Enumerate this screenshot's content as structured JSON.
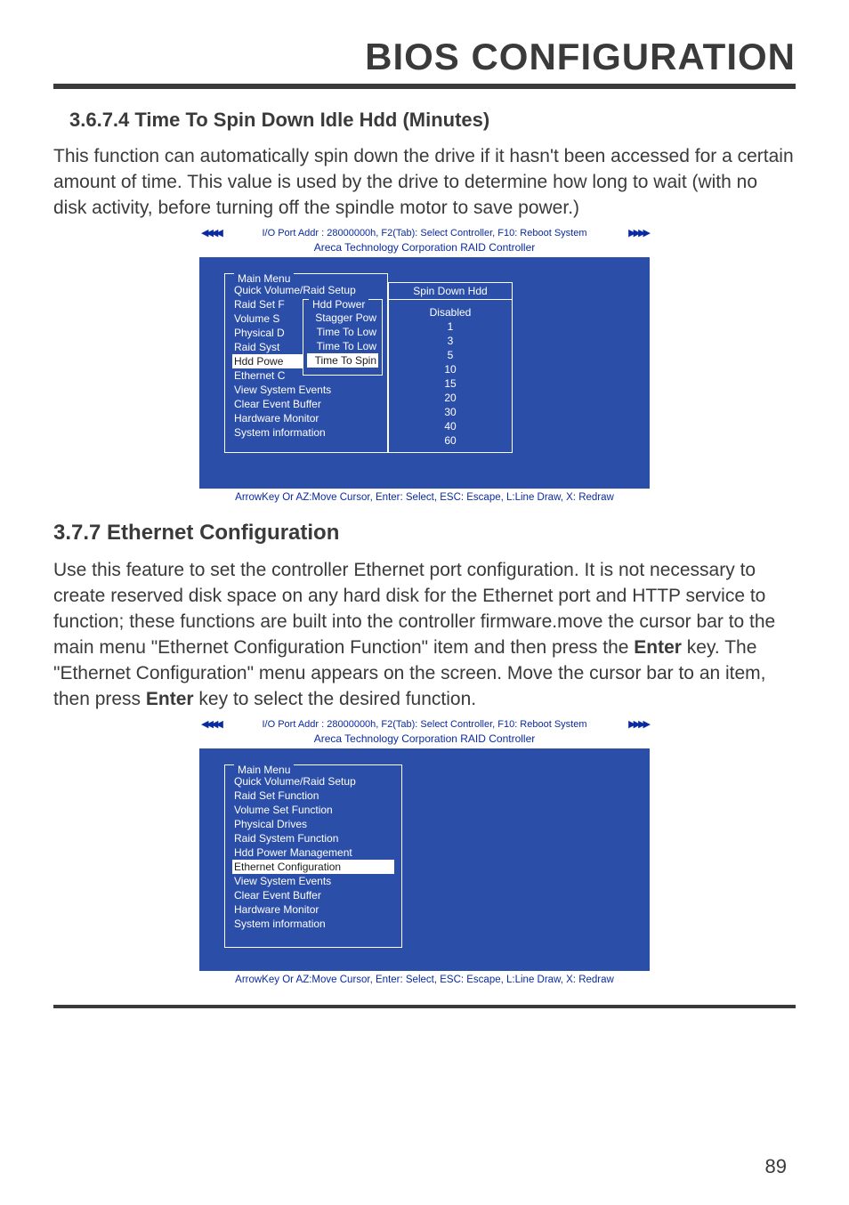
{
  "header": "BIOS CONFIGURATION",
  "section1": {
    "num_title": "3.6.7.4 Time To Spin Down Idle Hdd (Minutes)",
    "para": "This function can automatically spin down the drive if it hasn't been accessed for a certain amount of time. This value is used by the drive to determine how long to wait (with no disk activity, before turning off the spindle motor to save power.)"
  },
  "bios_common": {
    "top_status": "I/O Port Addr : 28000000h, F2(Tab): Select Controller, F10: Reboot System",
    "corp": "Areca Technology Corporation RAID Controller",
    "help": "ArrowKey Or AZ:Move Cursor, Enter: Select, ESC: Escape, L:Line Draw, X: Redraw",
    "main_menu_title": "Main Menu",
    "arrows_l": "◀◀◀◀",
    "arrows_r": "▶▶▶▶"
  },
  "bios1": {
    "main_items": [
      "Quick Volume/Raid Setup",
      "Raid Set F",
      "Volume S",
      "Physical D",
      "Raid Syst",
      "Hdd Powe",
      "Ethernet C",
      "View System Events",
      "Clear Event Buffer",
      "Hardware Monitor",
      "System information"
    ],
    "sub_title": "Hdd Power",
    "sub_items": [
      "Stagger Pow",
      "Time To Low",
      "Time To Low",
      "Time To Spin"
    ],
    "popup_title": "Spin Down Hdd",
    "popup_items": [
      "Disabled",
      "1",
      "3",
      "5",
      "10",
      "15",
      "20",
      "30",
      "40",
      "60"
    ]
  },
  "section2": {
    "title": "3.7.7 Ethernet Configuration",
    "para_a": "Use this feature to set the controller Ethernet port configuration. It is not necessary to create reserved disk space on any hard disk for the Ethernet port and HTTP service to function; these functions are built into the controller firmware.move the cursor bar to the main menu \"Ethernet Configuration Function\" item and then press the ",
    "enter1": "Enter",
    "para_b": " key. The \"Ethernet Configuration\" menu appears on the screen. Move the cursor bar to an item, then press ",
    "enter2": "Enter",
    "para_c": " key to select the desired function."
  },
  "bios2": {
    "main_items": [
      "Quick Volume/Raid Setup",
      "Raid Set Function",
      "Volume Set Function",
      "Physical Drives",
      "Raid System Function",
      "Hdd Power Management",
      "Ethernet Configuration",
      "View System Events",
      "Clear Event Buffer",
      "Hardware Monitor",
      "System information"
    ]
  },
  "page_number": "89"
}
